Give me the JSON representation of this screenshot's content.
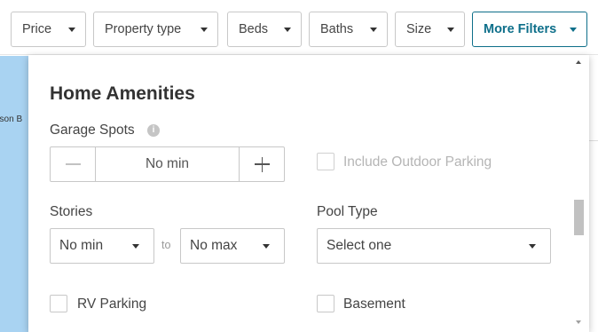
{
  "filters": [
    {
      "label": "Price"
    },
    {
      "label": "Property type"
    },
    {
      "label": "Beds"
    },
    {
      "label": "Baths"
    },
    {
      "label": "Size"
    },
    {
      "label": "More Filters"
    }
  ],
  "map": {
    "label": "nson B"
  },
  "panel": {
    "title": "Home Amenities",
    "garage": {
      "label": "Garage Spots",
      "info_icon": "i",
      "minus": "minus-icon",
      "value": "No min",
      "plus": "plus-icon"
    },
    "outdoor_parking": {
      "label": "Include Outdoor Parking",
      "checked": false,
      "disabled": true
    },
    "stories": {
      "label": "Stories",
      "min": "No min",
      "to": "to",
      "max": "No max"
    },
    "pool": {
      "label": "Pool Type",
      "value": "Select one"
    },
    "rv_parking": {
      "label": "RV Parking",
      "checked": false
    },
    "basement": {
      "label": "Basement",
      "checked": false
    }
  },
  "colors": {
    "accent": "#0e6f8a",
    "map": "#a9d3f2"
  }
}
